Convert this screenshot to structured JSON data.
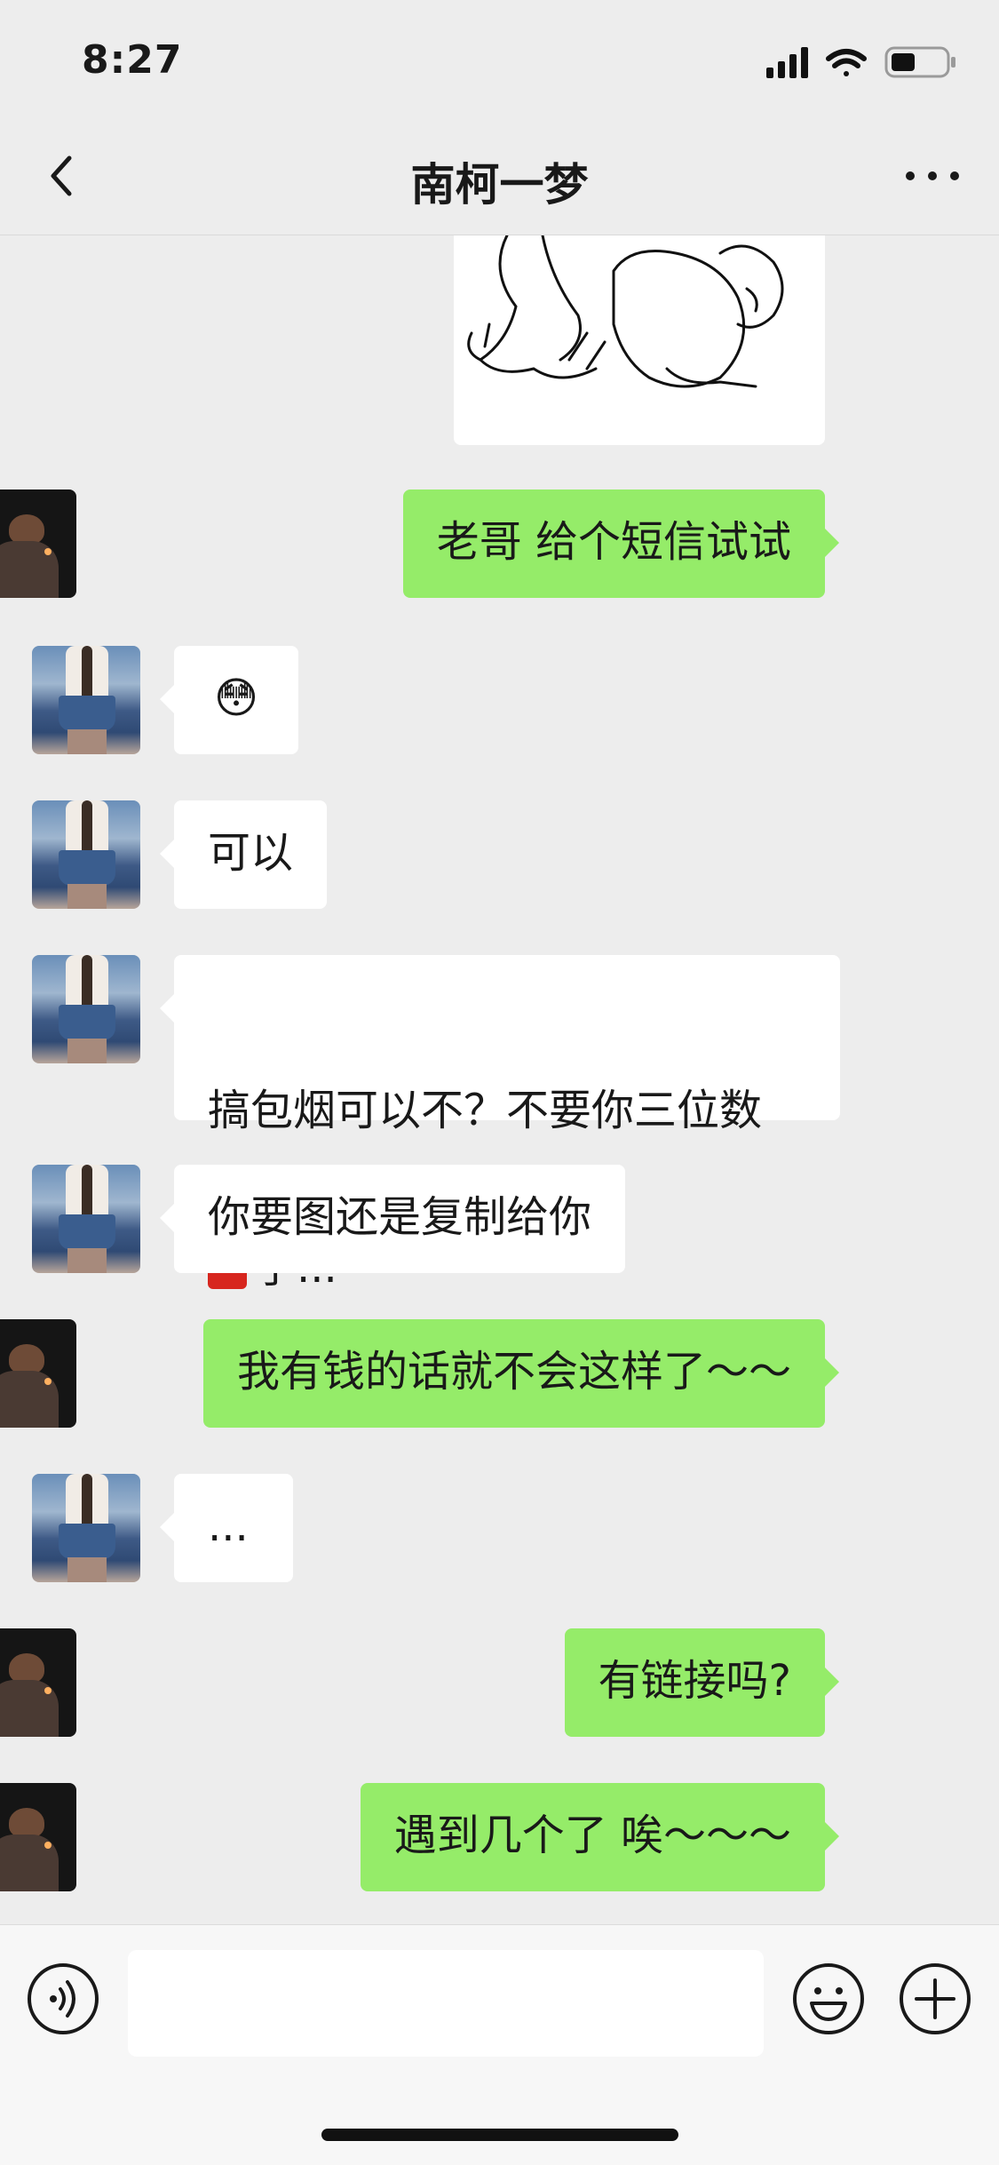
{
  "status_bar": {
    "time": "8:27"
  },
  "nav": {
    "title": "南柯一梦"
  },
  "messages": [
    {
      "side": "right",
      "type": "image"
    },
    {
      "side": "right",
      "type": "text",
      "text": "老哥 给个短信试试"
    },
    {
      "side": "left",
      "type": "emoji",
      "text": "😳"
    },
    {
      "side": "left",
      "type": "text",
      "text": "可以"
    },
    {
      "side": "left",
      "type": "text",
      "text_line1": "搞包烟可以不？不要你三位数",
      "text_line2": "了..."
    },
    {
      "side": "left",
      "type": "text",
      "text": "你要图还是复制给你"
    },
    {
      "side": "right",
      "type": "text",
      "text": "我有钱的话就不会这样了～～"
    },
    {
      "side": "left",
      "type": "text",
      "text": "..."
    },
    {
      "side": "right",
      "type": "text",
      "text": "有链接吗?"
    },
    {
      "side": "right",
      "type": "text",
      "text": "遇到几个了 唉～～～"
    }
  ],
  "icons": {
    "back": "chevron-left-icon",
    "more": "more-dots-icon",
    "voice": "voice-icon",
    "emoji": "smiley-icon",
    "plus": "plus-icon",
    "red_packet": "red-packet-emoji"
  },
  "colors": {
    "background": "#ededed",
    "self_bubble": "#95ec69",
    "other_bubble": "#ffffff"
  }
}
